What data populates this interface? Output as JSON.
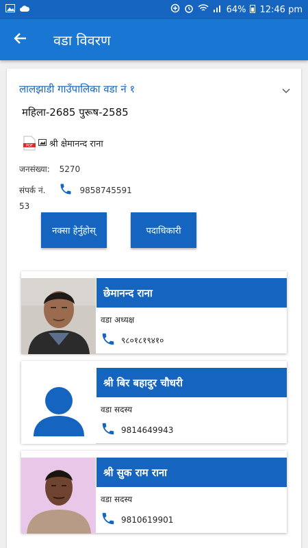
{
  "status": {
    "battery": "64%",
    "time": "12:46 pm"
  },
  "appbar": {
    "title": "वडा विवरण"
  },
  "ward": {
    "heading": "लालझाडी गाउँपालिका वडा नं १",
    "gender": "महिला-2685 पुरूष-2585",
    "chair_caption": "श्री क्षेमानन्द राना",
    "population_label": "जनसंख्या:",
    "population_value": "5270",
    "contact_label": "संपर्क नं.",
    "contact_value": "9858745591",
    "contact_extra": "53",
    "map_button": "नक्सा हेर्नुहोस्",
    "officials_button": "पदाधिकारी"
  },
  "members": [
    {
      "name": "छेमानन्द राना",
      "role": "वडा अध्यक्ष",
      "phone": "९८०१८१९४१०"
    },
    {
      "name": "श्री बिर बहादुर चौधरी",
      "role": "वडा सदस्य",
      "phone": "9814649943"
    },
    {
      "name": "श्री सुक राम राना",
      "role": "वडा सदस्य",
      "phone": "9810619901"
    }
  ],
  "colors": {
    "primary": "#1976d2",
    "dark": "#1565c0"
  },
  "icons": [
    "back-arrow-icon",
    "chevron-down-icon",
    "pdf-icon",
    "phone-icon",
    "person-placeholder-icon"
  ]
}
